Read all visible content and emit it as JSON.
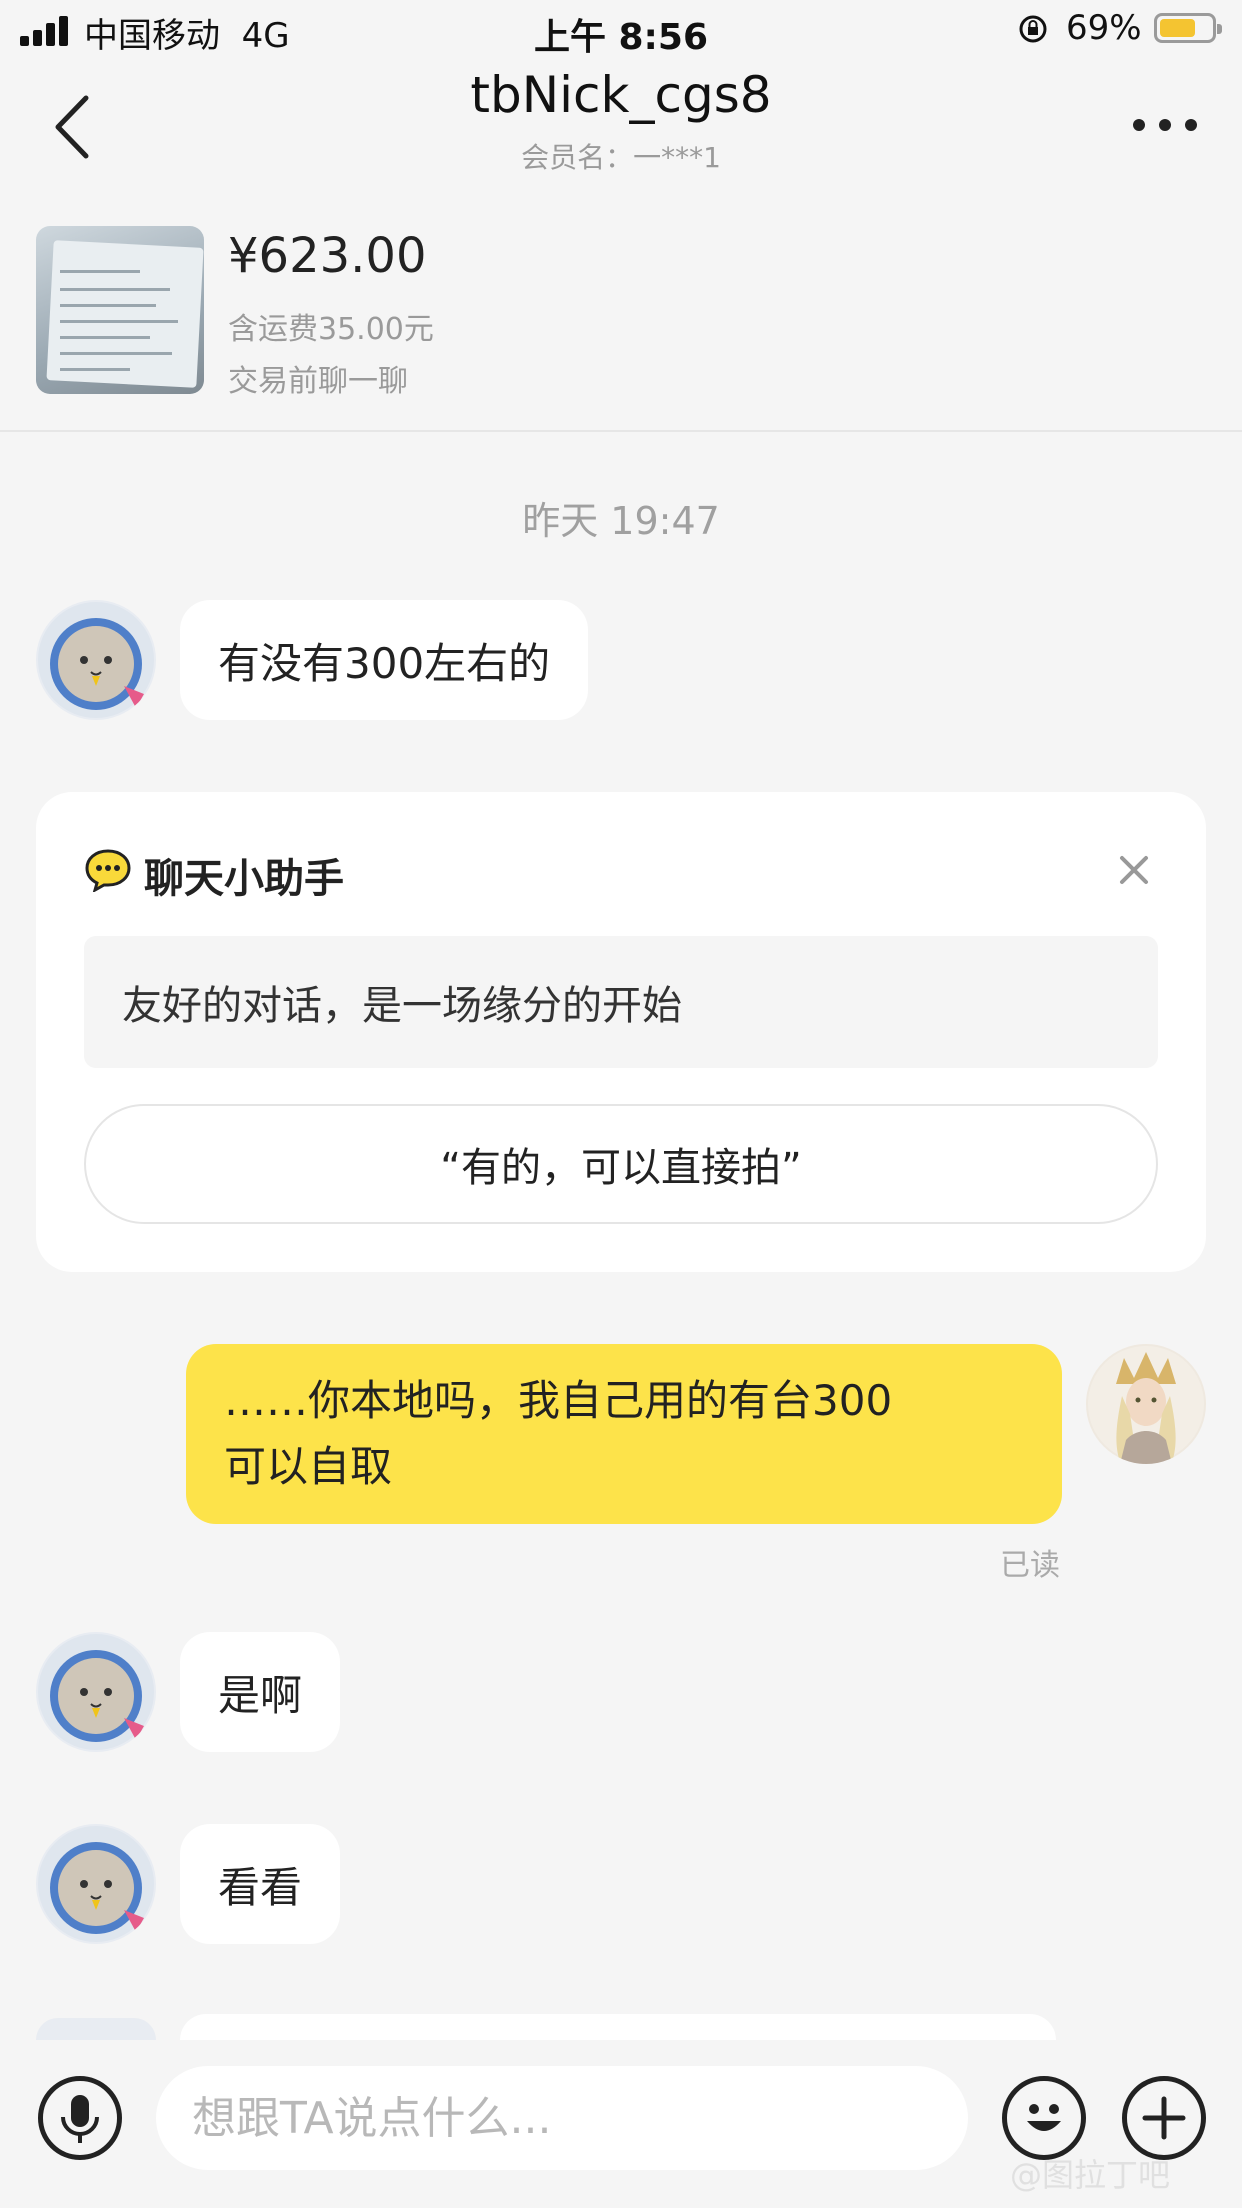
{
  "status_bar": {
    "carrier": "中国移动",
    "network": "4G",
    "time": "上午 8:56",
    "battery_percent": "69%",
    "battery_level": 0.69
  },
  "nav": {
    "title": "tbNick_cgs8",
    "subtitle": "会员名：一***1",
    "back_icon": "chevron-left-icon",
    "more_icon": "more-dots-icon"
  },
  "product": {
    "price": "¥623.00",
    "shipping": "含运费35.00元",
    "pre_trade": "交易前聊一聊"
  },
  "chat": {
    "timestamp": "昨天 19:47",
    "messages": [
      {
        "from": "other",
        "text": "有没有300左右的"
      },
      {
        "from": "me",
        "line1": "……你本地吗，我自己用的有台300",
        "line2": "可以自取",
        "status": "已读"
      },
      {
        "from": "other",
        "text": "是啊"
      },
      {
        "from": "other",
        "text": "看看"
      }
    ]
  },
  "assistant": {
    "title": "聊天小助手",
    "tip": "友好的对话，是一场缘分的开始",
    "suggestion": "“有的，可以直接拍”"
  },
  "input_bar": {
    "placeholder": "想跟TA说点什么...",
    "watermark": "@图拉丁吧"
  },
  "colors": {
    "accent_yellow": "#fde34a",
    "background": "#f5f5f5",
    "bubble_in": "#ffffff",
    "battery_fill": "#f4c431"
  }
}
